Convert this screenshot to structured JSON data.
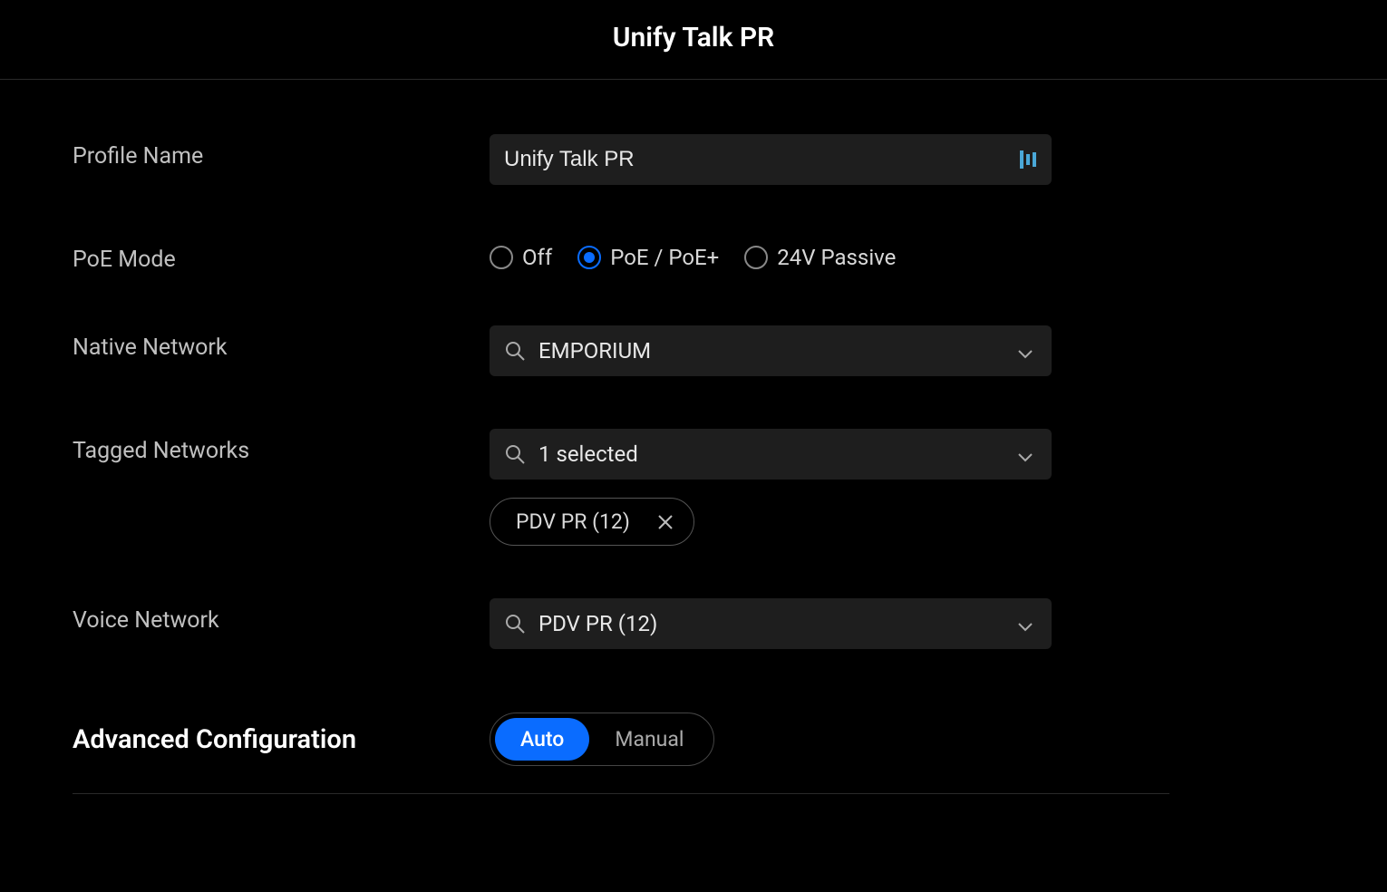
{
  "header": {
    "title": "Unify Talk PR"
  },
  "form": {
    "profileName": {
      "label": "Profile Name",
      "value": "Unify Talk PR"
    },
    "poeMode": {
      "label": "PoE Mode",
      "options": [
        {
          "label": "Off",
          "selected": false
        },
        {
          "label": "PoE / PoE+",
          "selected": true
        },
        {
          "label": "24V Passive",
          "selected": false
        }
      ]
    },
    "nativeNetwork": {
      "label": "Native Network",
      "value": "EMPORIUM"
    },
    "taggedNetworks": {
      "label": "Tagged Networks",
      "summary": "1 selected",
      "chips": [
        {
          "label": "PDV PR (12)"
        }
      ]
    },
    "voiceNetwork": {
      "label": "Voice Network",
      "value": "PDV PR (12)"
    }
  },
  "advanced": {
    "title": "Advanced Configuration",
    "segments": [
      {
        "label": "Auto",
        "active": true
      },
      {
        "label": "Manual",
        "active": false
      }
    ]
  },
  "colors": {
    "accent": "#0a6cff",
    "background": "#000000",
    "inputBg": "#1e1e1e"
  }
}
